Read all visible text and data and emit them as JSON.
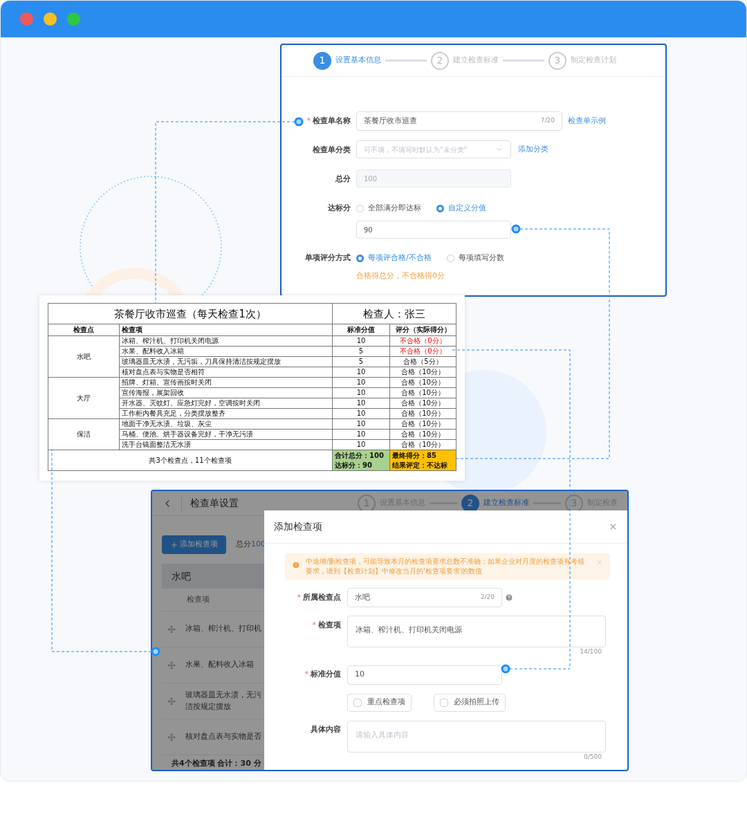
{
  "browser": {
    "dots": [
      {
        "color": "#ee5b57"
      },
      {
        "color": "#f5c024"
      },
      {
        "color": "#2ec840"
      }
    ]
  },
  "form": {
    "steps": [
      {
        "number": "1",
        "label": "设置基本信息",
        "selected": true
      },
      {
        "number": "2",
        "label": "建立检查标准",
        "selected": false
      },
      {
        "number": "3",
        "label": "制定检查计划",
        "selected": false
      }
    ],
    "fields": [
      {
        "kind": "input",
        "label": "检查单名称",
        "required_mark": "*",
        "value": "茶餐厅收市巡查",
        "count": "7/20",
        "link": "检查单示例"
      },
      {
        "kind": "select",
        "label": "检查单分类",
        "placeholder": "可不填，不填写时默认为\"未分类\"",
        "link": "添加分类"
      },
      {
        "kind": "disabled",
        "label": "总分",
        "value": "100"
      },
      {
        "kind": "radio_input",
        "label": "达标分",
        "options": [
          {
            "label": "全部满分即达标",
            "selected": false
          },
          {
            "label": "自定义分值",
            "selected": true
          }
        ],
        "value": "90"
      },
      {
        "kind": "radio",
        "label": "单项评分方式",
        "options": [
          {
            "label": "每项评合格/不合格",
            "selected": true
          },
          {
            "label": "每项填写分数",
            "selected": false
          }
        ],
        "hint": "合格得总分，不合格得0分"
      }
    ]
  },
  "sheet": {
    "title": "茶餐厅收市巡查（每天检查1次）",
    "inspector": "检查人：张三",
    "columns": [
      "检查点",
      "检查项",
      "标准分值",
      "评分（实际得分）"
    ],
    "groups": [
      {
        "point": "水吧",
        "items": [
          {
            "text": "冰箱、榨汁机、打印机关闭电源",
            "standard": "10",
            "score": "不合格（0分）",
            "passed": false
          },
          {
            "text": "水果、配料收入冰箱",
            "standard": "5",
            "score": "不合格（0分）",
            "passed": false
          },
          {
            "text": "玻璃器皿无水渍，无污垢，刀具保持清洁按规定摆放",
            "standard": "5",
            "score": "合格（5分）",
            "passed": true
          },
          {
            "text": "核对盘点表与实物是否相符",
            "standard": "10",
            "score": "合格（10分）",
            "passed": true
          }
        ]
      },
      {
        "point": "大厅",
        "items": [
          {
            "text": "招牌、灯箱、宣传画按时关闭",
            "standard": "10",
            "score": "合格（10分）",
            "passed": true
          },
          {
            "text": "宣传海报，展架回收",
            "standard": "10",
            "score": "合格（10分）",
            "passed": true
          },
          {
            "text": "开水器、灭蚊灯、应急灯完好，空调按时关闭",
            "standard": "10",
            "score": "合格（10分）",
            "passed": true
          },
          {
            "text": "工作柜内餐具充足，分类摆放整齐",
            "standard": "10",
            "score": "合格（10分）",
            "passed": true
          }
        ]
      },
      {
        "point": "保洁",
        "items": [
          {
            "text": "地面干净无水渍、垃圾、灰尘",
            "standard": "10",
            "score": "合格（10分）",
            "passed": true
          },
          {
            "text": "马桶、便池、烘手器设备完好，干净无污渍",
            "standard": "10",
            "score": "合格（10分）",
            "passed": true
          },
          {
            "text": "洗手台镜面整洁无水渍",
            "standard": "10",
            "score": "合格（10分）",
            "passed": true
          }
        ]
      }
    ],
    "summary": "共3个检查点，11个检查项",
    "totals": [
      "合计总分：100",
      "达标分：90"
    ],
    "result": [
      "最终得分：85",
      "结果评定：不达标"
    ]
  },
  "editor": {
    "title": "检查单设置",
    "steps": [
      {
        "number": "1",
        "label": "设置基本信息",
        "selected": false
      },
      {
        "number": "2",
        "label": "建立检查标准",
        "selected": true
      },
      {
        "number": "3",
        "label": "制定检查",
        "selected": false
      }
    ],
    "add_button": "添加检查项",
    "total_label": "总分",
    "total_value": "100",
    "group": "水吧",
    "column": "检查项",
    "rows": [
      {
        "lines": [
          "冰箱、榨汁机、打印机"
        ]
      },
      {
        "lines": [
          "水果、配料收入冰箱"
        ]
      },
      {
        "lines": [
          "玻璃器皿无水渍，无污",
          "洁按规定摆放"
        ]
      },
      {
        "lines": [
          "核对盘点表与实物是否"
        ]
      }
    ],
    "footer": "共4个检查项 合计：30 分"
  },
  "dialog": {
    "title": "添加检查项",
    "alert": "中途增/删检查项，可能导致本月的检查项要求总数不准确；如果企业对月度的检查项有考核要求，请到【检查计划】中修改当月的'检查项要求'的数值",
    "fields": [
      {
        "kind": "input",
        "label": "所属检查点",
        "required_mark": "*",
        "value": "水吧",
        "count": "2/20",
        "help": true
      },
      {
        "kind": "textarea",
        "label": "检查项",
        "required_mark": "*",
        "value": "冰箱、榨汁机、打印机关闭电源",
        "count": "14/100"
      },
      {
        "kind": "input",
        "label": "标准分值",
        "required_mark": "*",
        "value": "10"
      },
      {
        "kind": "checkboxes",
        "options": [
          {
            "label": "重点检查项",
            "checked": false
          },
          {
            "label": "必须拍照上传",
            "checked": false
          }
        ]
      },
      {
        "kind": "textarea",
        "label": "具体内容",
        "placeholder": "请输入具体内容",
        "count": "0/500"
      }
    ]
  }
}
